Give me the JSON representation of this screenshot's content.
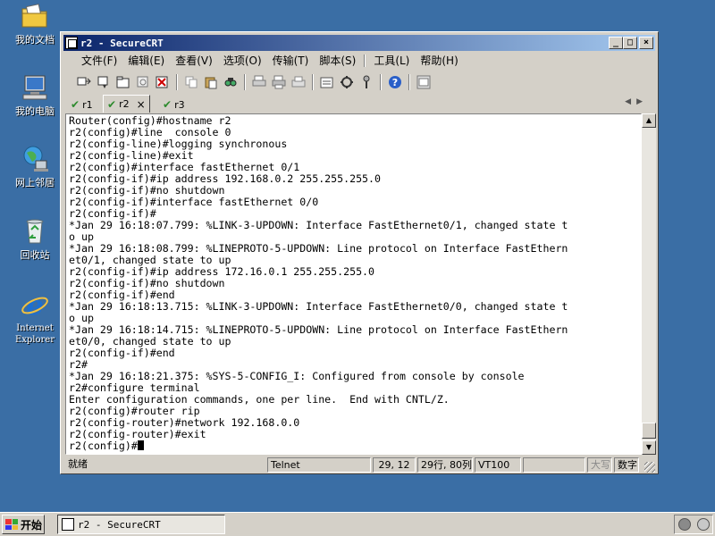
{
  "desktop": {
    "icons": [
      {
        "label": "我的文档",
        "icon": "folder-documents-icon"
      },
      {
        "label": "我的电脑",
        "icon": "my-computer-icon"
      },
      {
        "label": "网上邻居",
        "icon": "network-places-icon"
      },
      {
        "label": "回收站",
        "icon": "recycle-bin-icon"
      },
      {
        "label": "Internet Explorer",
        "icon": "internet-explorer-icon"
      }
    ]
  },
  "window": {
    "title": "r2 - SecureCRT",
    "controls": {
      "minimize": "_",
      "maximize": "□",
      "close": "×"
    }
  },
  "menu": {
    "items": [
      "文件(F)",
      "编辑(E)",
      "查看(V)",
      "选项(O)",
      "传输(T)",
      "脚本(S)",
      "工具(L)",
      "帮助(H)"
    ]
  },
  "tabs": {
    "items": [
      {
        "label": "r1",
        "status": "connected"
      },
      {
        "label": "r2",
        "status": "connected",
        "active": true,
        "close": "×"
      },
      {
        "label": "r3",
        "status": "connected"
      }
    ],
    "scroll_left": "◀",
    "scroll_right": "▶"
  },
  "terminal": {
    "lines": [
      "Router(config)#hostname r2",
      "r2(config)#line  console 0",
      "r2(config-line)#logging synchronous",
      "r2(config-line)#exit",
      "r2(config)#interface fastEthernet 0/1",
      "r2(config-if)#ip address 192.168.0.2 255.255.255.0",
      "r2(config-if)#no shutdown",
      "r2(config-if)#interface fastEthernet 0/0",
      "r2(config-if)#",
      "*Jan 29 16:18:07.799: %LINK-3-UPDOWN: Interface FastEthernet0/1, changed state t",
      "o up",
      "*Jan 29 16:18:08.799: %LINEPROTO-5-UPDOWN: Line protocol on Interface FastEthern",
      "et0/1, changed state to up",
      "r2(config-if)#ip address 172.16.0.1 255.255.255.0",
      "r2(config-if)#no shutdown",
      "r2(config-if)#end",
      "*Jan 29 16:18:13.715: %LINK-3-UPDOWN: Interface FastEthernet0/0, changed state t",
      "o up",
      "*Jan 29 16:18:14.715: %LINEPROTO-5-UPDOWN: Line protocol on Interface FastEthern",
      "et0/0, changed state to up",
      "r2(config-if)#end",
      "r2#",
      "*Jan 29 16:18:21.375: %SYS-5-CONFIG_I: Configured from console by console",
      "r2#configure terminal",
      "Enter configuration commands, one per line.  End with CNTL/Z.",
      "r2(config)#router rip",
      "r2(config-router)#network 192.168.0.0",
      "r2(config-router)#exit"
    ],
    "prompt": "r2(config)#"
  },
  "status": {
    "ready": "就绪",
    "protocol": "Telnet",
    "cursor_pos": "29, 12",
    "size": "29行, 80列",
    "emulation": "VT100",
    "extra": "",
    "caps": "大写",
    "num": "数字"
  },
  "taskbar": {
    "start": "开始",
    "task_label": "r2 - SecureCRT"
  }
}
